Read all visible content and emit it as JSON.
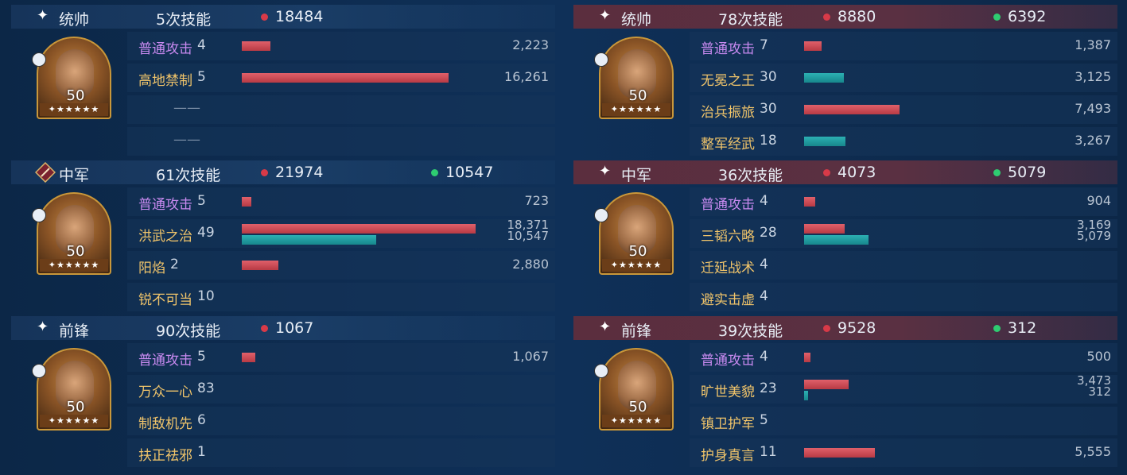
{
  "left": {
    "sections": [
      {
        "role": "统帅",
        "casts": "5次技能",
        "red": "18484",
        "green": "",
        "level": "50",
        "stars": "✦★★★★★",
        "rows": [
          {
            "skill": "普通攻击",
            "lv": "4",
            "red_val": "2,223",
            "green_val": ""
          },
          {
            "skill": "高地禁制",
            "lv": "5",
            "red_val": "16,261",
            "green_val": ""
          },
          {
            "skill": "",
            "lv": "——",
            "red_val": "",
            "green_val": ""
          },
          {
            "skill": "",
            "lv": "——",
            "red_val": "",
            "green_val": ""
          }
        ]
      },
      {
        "role": "中军",
        "casts": "61次技能",
        "red": "21974",
        "green": "10547",
        "level": "50",
        "stars": "✦★★★★★",
        "rows": [
          {
            "skill": "普通攻击",
            "lv": "5",
            "red_val": "723",
            "green_val": ""
          },
          {
            "skill": "洪武之治",
            "lv": "49",
            "red_val": "18,371",
            "green_val": "10,547"
          },
          {
            "skill": "阳焰",
            "lv": "2",
            "red_val": "2,880",
            "green_val": ""
          },
          {
            "skill": "锐不可当",
            "lv": "10",
            "red_val": "",
            "green_val": ""
          }
        ]
      },
      {
        "role": "前锋",
        "casts": "90次技能",
        "red": "1067",
        "green": "",
        "level": "50",
        "stars": "✦★★★★★",
        "rows": [
          {
            "skill": "普通攻击",
            "lv": "5",
            "red_val": "1,067",
            "green_val": ""
          },
          {
            "skill": "万众一心",
            "lv": "83",
            "red_val": "",
            "green_val": ""
          },
          {
            "skill": "制敌机先",
            "lv": "6",
            "red_val": "",
            "green_val": ""
          },
          {
            "skill": "扶正祛邪",
            "lv": "1",
            "red_val": "",
            "green_val": ""
          }
        ]
      }
    ]
  },
  "right": {
    "sections": [
      {
        "role": "统帅",
        "casts": "78次技能",
        "red": "8880",
        "green": "6392",
        "level": "50",
        "stars": "✦★★★★★",
        "rows": [
          {
            "skill": "普通攻击",
            "lv": "7",
            "red_val": "1,387",
            "green_val": ""
          },
          {
            "skill": "无冕之王",
            "lv": "30",
            "red_val": "",
            "green_val": "3,125"
          },
          {
            "skill": "治兵振旅",
            "lv": "30",
            "red_val": "7,493",
            "green_val": ""
          },
          {
            "skill": "整军经武",
            "lv": "18",
            "red_val": "",
            "green_val": "3,267"
          }
        ]
      },
      {
        "role": "中军",
        "casts": "36次技能",
        "red": "4073",
        "green": "5079",
        "level": "50",
        "stars": "✦★★★★★",
        "rows": [
          {
            "skill": "普通攻击",
            "lv": "4",
            "red_val": "904",
            "green_val": ""
          },
          {
            "skill": "三韬六略",
            "lv": "28",
            "red_val": "3,169",
            "green_val": "5,079"
          },
          {
            "skill": "迁延战术",
            "lv": "4",
            "red_val": "",
            "green_val": ""
          },
          {
            "skill": "避实击虚",
            "lv": "4",
            "red_val": "",
            "green_val": ""
          }
        ]
      },
      {
        "role": "前锋",
        "casts": "39次技能",
        "red": "9528",
        "green": "312",
        "level": "50",
        "stars": "✦★★★★★",
        "rows": [
          {
            "skill": "普通攻击",
            "lv": "4",
            "red_val": "500",
            "green_val": ""
          },
          {
            "skill": "旷世美貌",
            "lv": "23",
            "red_val": "3,473",
            "green_val": "312"
          },
          {
            "skill": "镇卫护军",
            "lv": "5",
            "red_val": "",
            "green_val": ""
          },
          {
            "skill": "护身真言",
            "lv": "11",
            "red_val": "5,555",
            "green_val": ""
          }
        ]
      }
    ]
  },
  "colors": {
    "red_dot": "#d83a48",
    "green_dot": "#2ecc71",
    "skill_normal": "#c88af0",
    "skill_gold": "#f0c46a"
  }
}
